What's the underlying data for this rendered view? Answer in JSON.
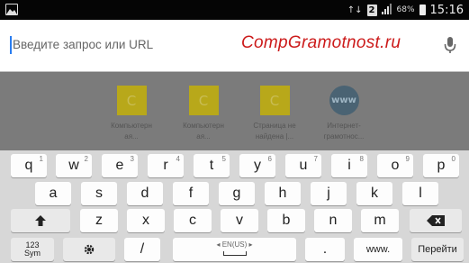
{
  "status_bar": {
    "sim_label": "2",
    "battery_percent": "68%",
    "time": "15:16"
  },
  "address_bar": {
    "placeholder": "Введите запрос или URL",
    "brand": "CompGramotnost.ru"
  },
  "shortcuts": [
    {
      "letter": "C",
      "label_line1": "Компьютерн",
      "label_line2": "ая..."
    },
    {
      "letter": "C",
      "label_line1": "Компьютерн",
      "label_line2": "ая..."
    },
    {
      "letter": "C",
      "label_line1": "Страница не",
      "label_line2": "найдена |..."
    },
    {
      "letter": "www",
      "label_line1": "Интернет-",
      "label_line2": "грамотнос..."
    }
  ],
  "keyboard": {
    "row1": [
      {
        "char": "q",
        "sup": "1"
      },
      {
        "char": "w",
        "sup": "2"
      },
      {
        "char": "e",
        "sup": "3"
      },
      {
        "char": "r",
        "sup": "4"
      },
      {
        "char": "t",
        "sup": "5"
      },
      {
        "char": "y",
        "sup": "6"
      },
      {
        "char": "u",
        "sup": "7"
      },
      {
        "char": "i",
        "sup": "8"
      },
      {
        "char": "o",
        "sup": "9"
      },
      {
        "char": "p",
        "sup": "0"
      }
    ],
    "row2": [
      "a",
      "s",
      "d",
      "f",
      "g",
      "h",
      "j",
      "k",
      "l"
    ],
    "row3": [
      "z",
      "x",
      "c",
      "v",
      "b",
      "n",
      "m"
    ],
    "sym_top": "123",
    "sym_bottom": "Sym",
    "slash": "/",
    "space_lang": "EN(US)",
    "dot": ".",
    "www": "www.",
    "go": "Перейти"
  }
}
